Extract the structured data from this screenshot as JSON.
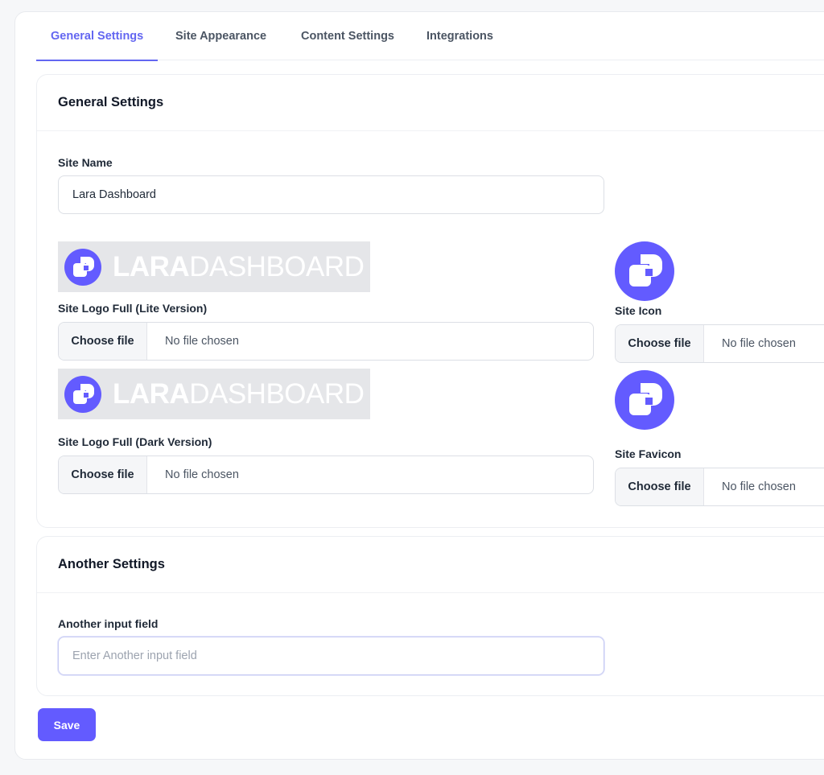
{
  "tabs": [
    {
      "label": "General Settings",
      "active": true
    },
    {
      "label": "Site Appearance",
      "active": false
    },
    {
      "label": "Content Settings",
      "active": false
    },
    {
      "label": "Integrations",
      "active": false
    }
  ],
  "general": {
    "title": "General Settings",
    "site_name": {
      "label": "Site Name",
      "value": "Lara Dashboard"
    },
    "logo_lite": {
      "label": "Site Logo Full (Lite Version)",
      "button": "Choose file",
      "status": "No file chosen"
    },
    "logo_dark": {
      "label": "Site Logo Full (Dark Version)",
      "button": "Choose file",
      "status": "No file chosen"
    },
    "site_icon": {
      "label": "Site Icon",
      "button": "Choose file",
      "status": "No file chosen"
    },
    "site_favicon": {
      "label": "Site Favicon",
      "button": "Choose file",
      "status": "No file chosen"
    },
    "logo_text_bold": "LARA",
    "logo_text_light": "DASHBOARD"
  },
  "another": {
    "title": "Another Settings",
    "field": {
      "label": "Another input field",
      "value": "",
      "placeholder": "Enter Another input field"
    }
  },
  "save_label": "Save",
  "colors": {
    "accent": "#6366f1",
    "brand": "#635bff"
  }
}
